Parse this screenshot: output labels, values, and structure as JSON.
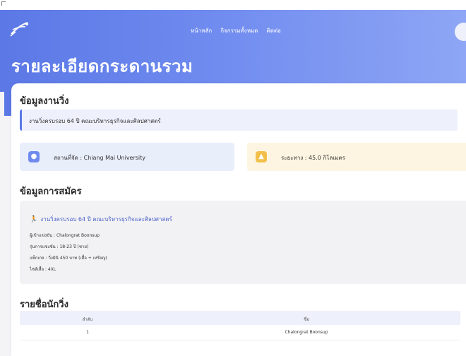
{
  "header": {
    "nav": [
      "หน้าหลัก",
      "กิจกรรมทั้งหมด",
      "ติดต่อ"
    ],
    "title": "รายละเอียดกระดานรวม"
  },
  "race_info": {
    "section_title": "ข้อมูลงานวิ่ง",
    "race_name": "งานวิ่งครบรอบ 64 ปี คณะบริหารธุรกิจและศิลปศาสตร์",
    "location": "สถานที่จัด : Chiang Mai University",
    "distance": "ระยะทาง : 45.0 กิโลเมตร"
  },
  "registration": {
    "section_title": "ข้อมูลการสมัคร",
    "event": "งานวิ่งครบรอบ 64 ปี คณะบริหารธุรกิจและศิลปศาสตร์",
    "runner": "ผู้เข้าแข่งขัน : Chalongrat Boonsup",
    "age_group": "รุ่นการแข่งขัน : 18-23 ปี (ชาย)",
    "package": "แพ็กเกจ : วิ่งมินิ 450 บาท (เสื้อ + เหรียญ)",
    "shirt_size": "ไซส์เสื้อ : 4XL"
  },
  "runners": {
    "section_title": "รายชื่อนักวิ่ง",
    "columns": [
      "ลำดับ",
      "ชื่อ"
    ],
    "rows": [
      [
        "1",
        "Chalongrat Boonsup"
      ]
    ]
  }
}
